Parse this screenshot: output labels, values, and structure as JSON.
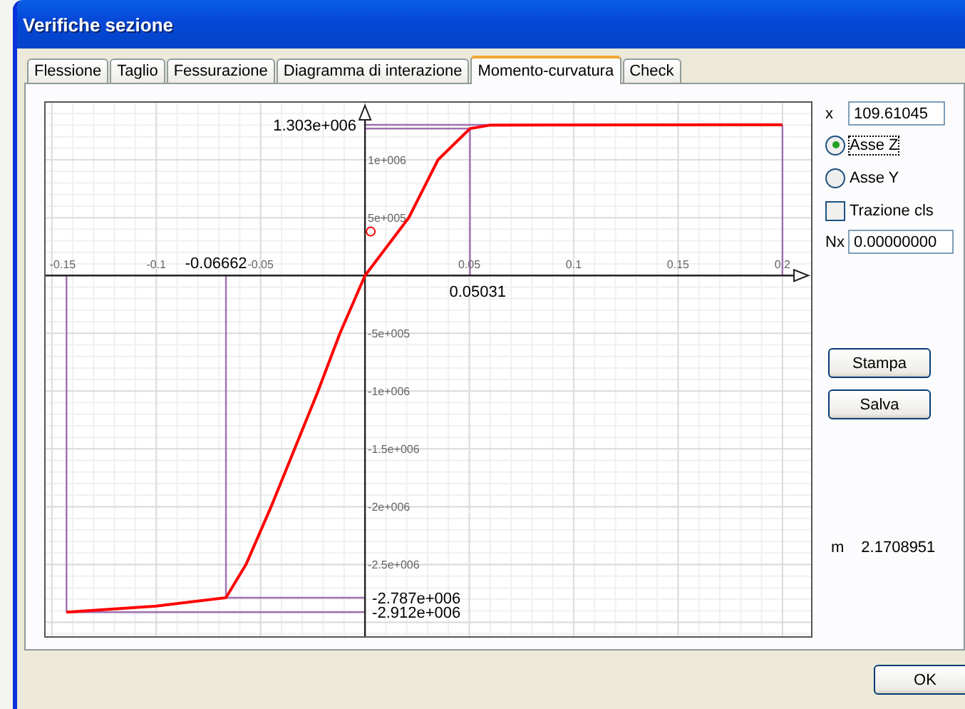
{
  "window": {
    "title": "Verifiche sezione"
  },
  "tabs": [
    {
      "label": "Flessione",
      "selected": false
    },
    {
      "label": "Taglio",
      "selected": false
    },
    {
      "label": "Fessurazione",
      "selected": false
    },
    {
      "label": "Diagramma di interazione",
      "selected": false
    },
    {
      "label": "Momento-curvatura",
      "selected": true
    },
    {
      "label": "Check",
      "selected": false
    }
  ],
  "chart": {
    "chart_data": {
      "type": "line",
      "grid": true,
      "xlim": [
        -0.153,
        0.2137
      ],
      "ylim": [
        -3120000,
        1494000
      ],
      "x": [
        -0.143,
        -0.1,
        -0.0666,
        -0.057,
        -0.045,
        -0.0225,
        -0.012,
        0,
        0.021,
        0.035,
        0.0503,
        0.06,
        0.2
      ],
      "series": [
        {
          "color": "#ff0000",
          "values": [
            -2912000,
            -2860000,
            -2787000,
            -2500000,
            -2000000,
            -1000000,
            -500000,
            0,
            500000,
            1000000,
            1270000,
            1300000,
            1303000
          ]
        }
      ],
      "xticks": [
        {
          "value": -0.15,
          "label": "-0.15"
        },
        {
          "value": -0.1,
          "label": "-0.1"
        },
        {
          "value": -0.05,
          "label": "-0.05"
        },
        {
          "value": 0.05,
          "label": "0.05"
        },
        {
          "value": 0.1,
          "label": "0.1"
        },
        {
          "value": 0.15,
          "label": "0.15"
        },
        {
          "value": 0.2,
          "label": "0.2"
        }
      ],
      "yticks": [
        {
          "value": 1000000,
          "label": "1e+006"
        },
        {
          "value": 500000,
          "label": "5e+005"
        },
        {
          "value": -500000,
          "label": "-5e+005"
        },
        {
          "value": -1000000,
          "label": "-1e+006"
        },
        {
          "value": -1500000,
          "label": "-1.5e+006"
        },
        {
          "value": -2000000,
          "label": "-2e+006"
        },
        {
          "value": -2500000,
          "label": "-2.5e+006"
        }
      ],
      "ref_lines": [
        {
          "axis": "x",
          "value": 0.2,
          "color": "#a070b0"
        },
        {
          "axis": "y",
          "value": 1303000,
          "color": "#a070b0"
        },
        {
          "axis": "x",
          "value": 0.0503,
          "color": "#a070b0"
        },
        {
          "axis": "y",
          "value": 1270000,
          "color": "#a070b0"
        },
        {
          "axis": "x",
          "value": -0.0666,
          "color": "#a070b0"
        },
        {
          "axis": "y",
          "value": -2787000,
          "color": "#a070b0"
        },
        {
          "axis": "x",
          "value": -0.143,
          "color": "#a070b0"
        },
        {
          "axis": "y",
          "value": -2912000,
          "color": "#a070b0"
        }
      ],
      "annotations": [
        "1.303e+006",
        "0.05031",
        "-0.06662",
        "-2.787e+006",
        "-2.912e+006"
      ]
    }
  },
  "x_field": {
    "label": "x",
    "value": "109.61045"
  },
  "axis_options": [
    {
      "label": "Asse Z",
      "selected": true
    },
    {
      "label": "Asse Y",
      "selected": false
    }
  ],
  "trazione": {
    "label": "Trazione cls",
    "checked": false
  },
  "nx_field": {
    "label": "Nx",
    "value": "0.00000000"
  },
  "buttons": [
    "Stampa",
    "Salva"
  ],
  "m_reading": {
    "label": "m",
    "value": "2.1708951"
  },
  "ok_button": "OK"
}
